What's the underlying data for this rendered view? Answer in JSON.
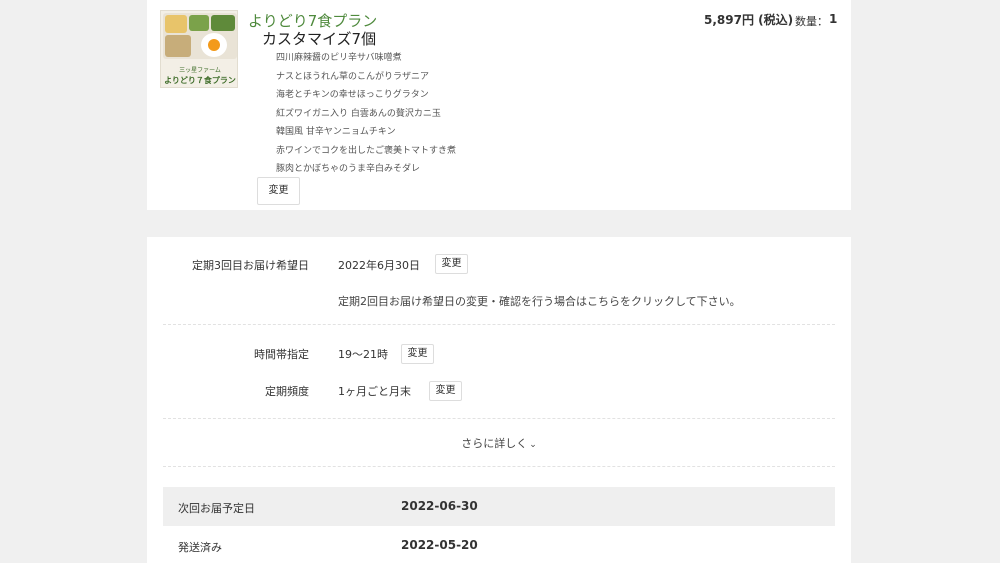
{
  "product": {
    "thumbnail": {
      "brand": "三ッ星ファーム",
      "plan": "よりどり７食プラン"
    },
    "name": "よりどり7食プラン",
    "subtitle": "カスタマイズ7個",
    "price": "5,897円 (税込)",
    "quantity_label": "数量：",
    "quantity_value": "1",
    "menu_items": [
      "四川麻辣醤のピリ辛サバ味噌煮",
      "ナスとほうれん草のこんがりラザニア",
      "海老とチキンの幸せほっこりグラタン",
      "紅ズワイガニ入り 白雲あんの贅沢カニ玉",
      "韓国風 甘辛ヤンニョムチキン",
      "赤ワインでコクを出したご褒美トマトすき煮",
      "豚肉とかぼちゃのうま辛白みそダレ"
    ],
    "change_label": "変更"
  },
  "delivery": {
    "date_label": "定期3回目お届け希望日",
    "date_value": "2022年6月30日",
    "date_change": "変更",
    "note": "定期2回目お届け希望日の変更・確認を行う場合はこちらをクリックして下さい。",
    "time_label": "時間帯指定",
    "time_value": "19～21時",
    "time_change": "変更",
    "freq_label": "定期頻度",
    "freq_value": "1ヶ月ごと月末",
    "freq_change": "変更",
    "more_label": "さらに詳しく",
    "more_icon": "chevron-down-icon"
  },
  "history": [
    {
      "label": "次回お届予定日",
      "value": "2022-06-30"
    },
    {
      "label": "発送済み",
      "value": "2022-05-20"
    }
  ],
  "colors": {
    "plan_name": "#4f8a3d",
    "background": "#f0f0f0",
    "row_grey": "#efefef"
  }
}
